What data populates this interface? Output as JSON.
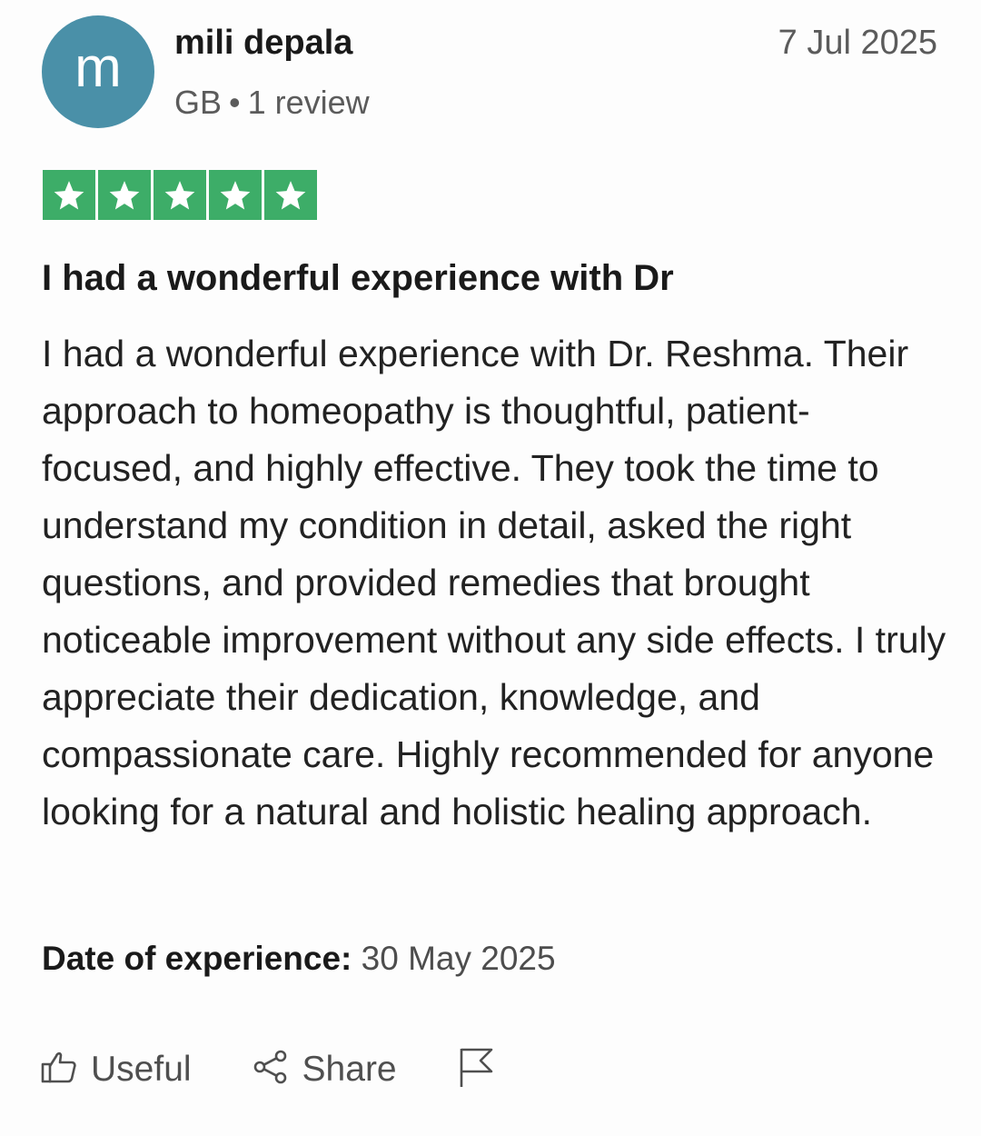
{
  "reviewer": {
    "initial": "m",
    "name": "mili depala",
    "country": "GB",
    "separator": "•",
    "review_count": "1 review",
    "avatar_color": "#4a90a8"
  },
  "review": {
    "date": "7 Jul 2025",
    "rating": 5,
    "rating_max": 5,
    "star_color": "#3dad68",
    "title": "I had a wonderful experience with Dr",
    "body": "I had a wonderful experience with Dr. Reshma. Their approach to homeopathy is thoughtful, patient-focused, and highly effective. They took the time to understand my condition in detail, asked the right questions, and provided remedies that brought noticeable improvement without any side effects. I truly appreciate their dedication, knowledge, and compassionate care. Highly recommended for anyone looking for a natural and holistic healing approach.",
    "experience_label": "Date of experience:",
    "experience_date": "30 May 2025"
  },
  "actions": {
    "useful_label": "Useful",
    "useful_icon": "thumbs-up-icon",
    "share_label": "Share",
    "share_icon": "share-icon",
    "report_icon": "flag-icon"
  }
}
